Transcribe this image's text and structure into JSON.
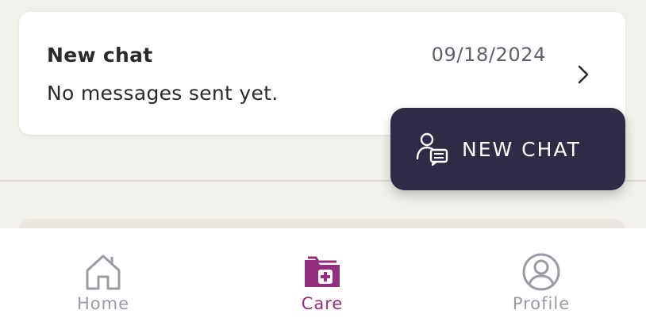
{
  "chat_list": {
    "items": [
      {
        "title": "New chat",
        "date": "09/18/2024",
        "preview": "No messages sent yet."
      }
    ]
  },
  "fab": {
    "label": "NEW CHAT",
    "icon": "person-chat-icon",
    "background": "#2f2a45"
  },
  "tabbar": {
    "tabs": [
      {
        "label": "Home",
        "icon": "home-icon",
        "active": false
      },
      {
        "label": "Care",
        "icon": "care-folder-icon",
        "active": true
      },
      {
        "label": "Profile",
        "icon": "profile-icon",
        "active": false
      }
    ],
    "active_color": "#932d7e",
    "inactive_color": "#9c9aa3"
  }
}
